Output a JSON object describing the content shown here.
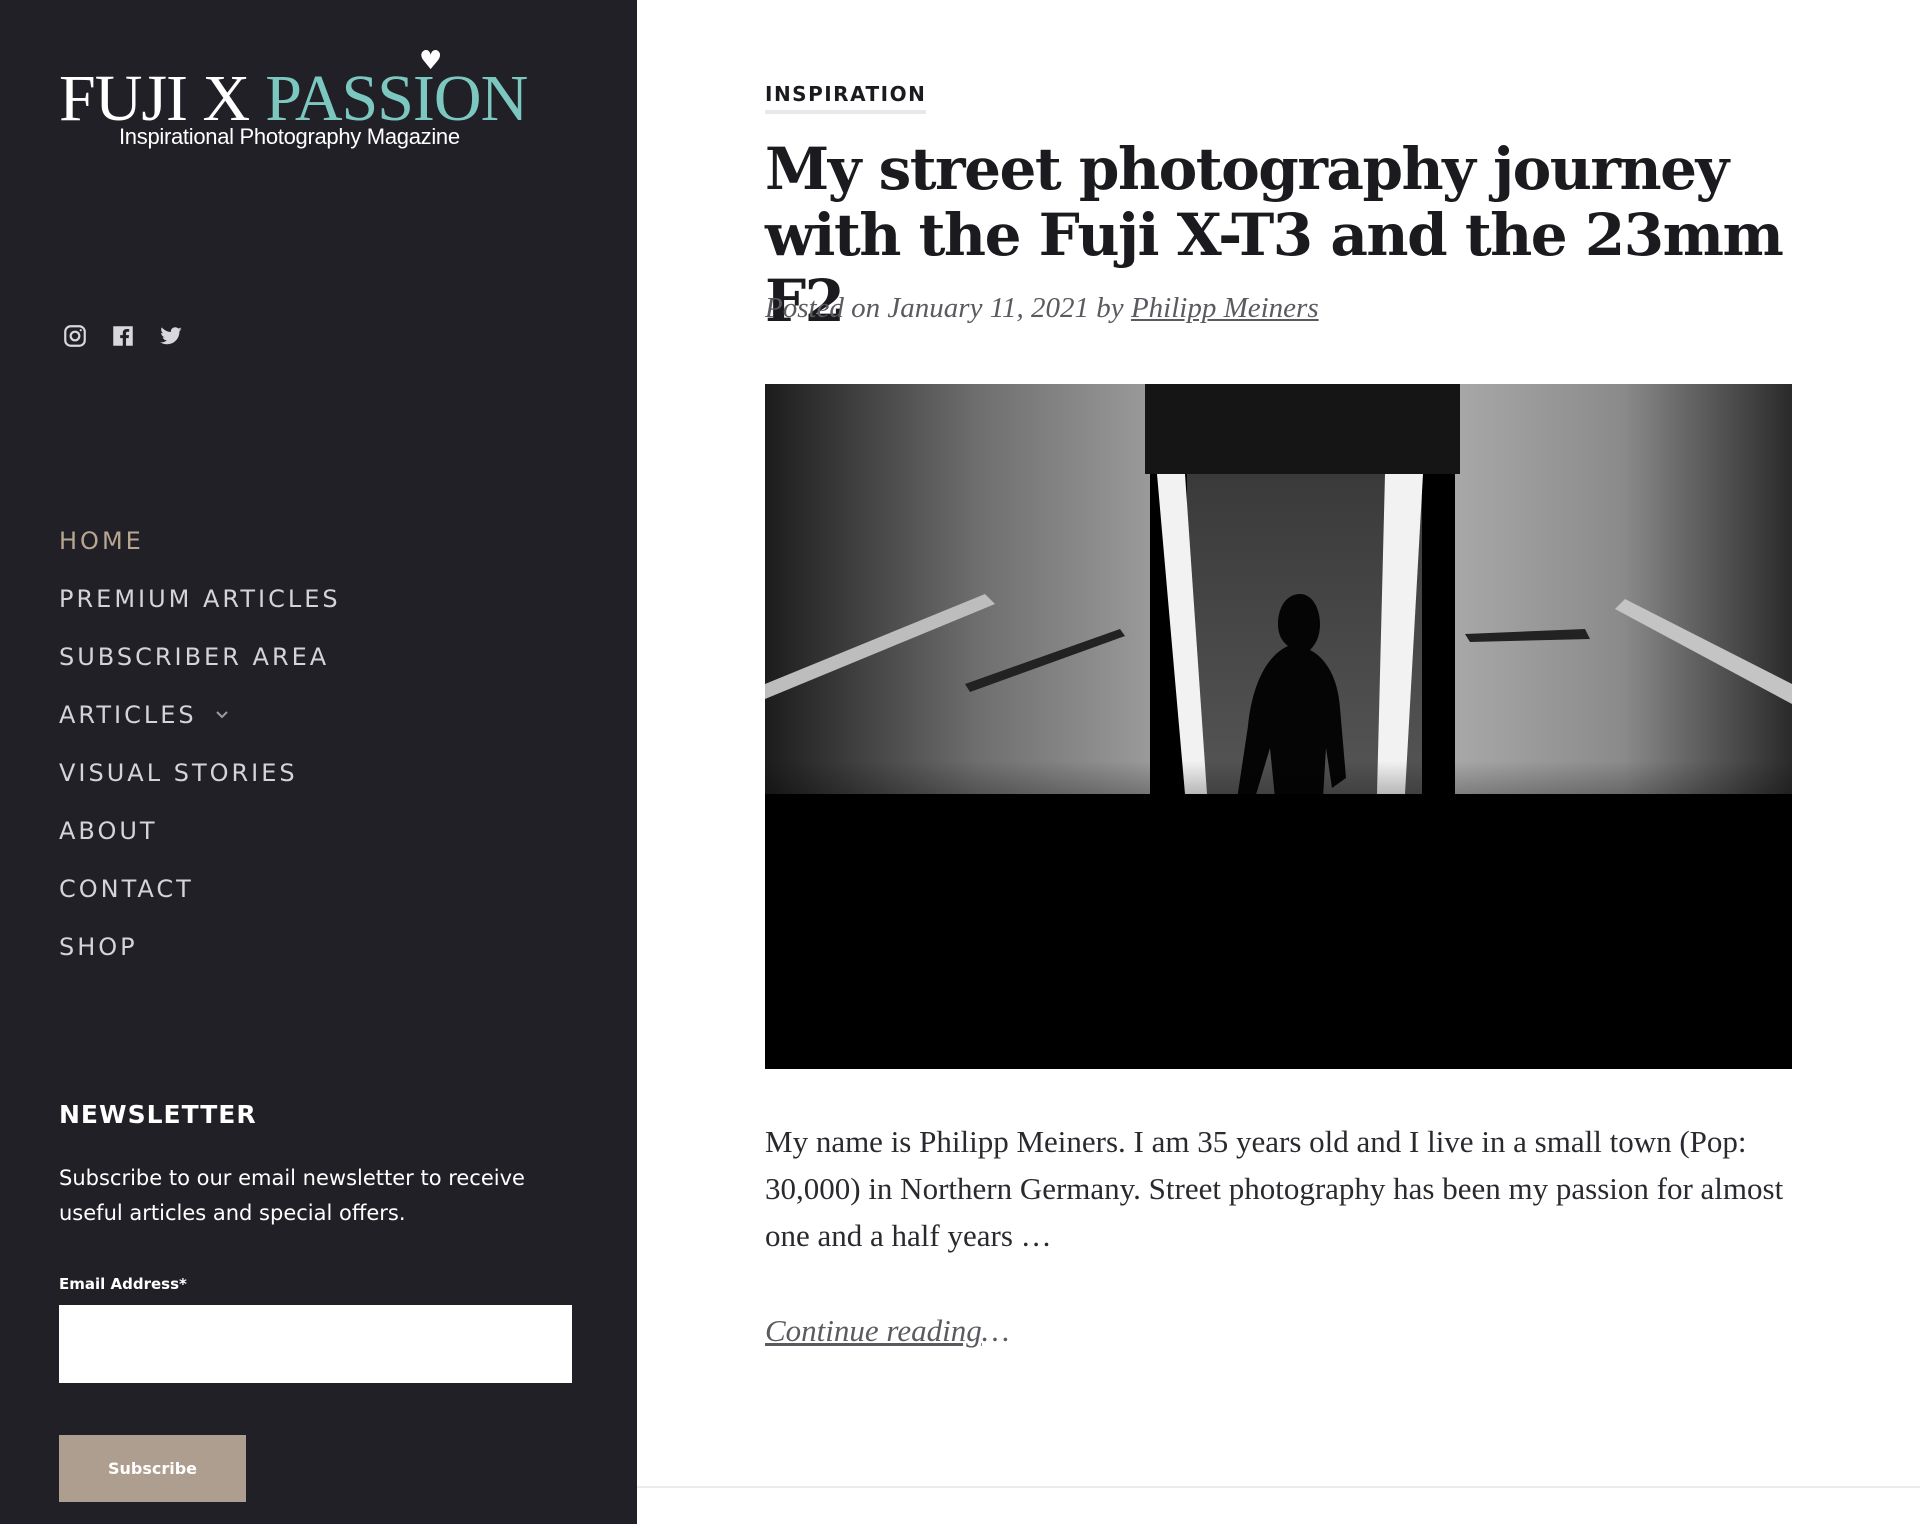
{
  "brand": {
    "name_part1": "FUJI X",
    "name_part2": "PASSION",
    "tagline": "Inspirational Photography Magazine",
    "heart_glyph": "♥",
    "accent_color": "#7cc8c0"
  },
  "social": [
    {
      "icon": "instagram-icon"
    },
    {
      "icon": "facebook-icon"
    },
    {
      "icon": "twitter-icon"
    }
  ],
  "nav": {
    "items": [
      {
        "label": "HOME",
        "active": true
      },
      {
        "label": "PREMIUM ARTICLES"
      },
      {
        "label": "SUBSCRIBER AREA"
      },
      {
        "label": "ARTICLES",
        "has_submenu": true
      },
      {
        "label": "VISUAL STORIES"
      },
      {
        "label": "ABOUT"
      },
      {
        "label": "CONTACT"
      },
      {
        "label": "SHOP"
      }
    ],
    "active_color": "#b8a690"
  },
  "newsletter": {
    "title": "NEWSLETTER",
    "description": "Subscribe to our email newsletter to receive useful articles and special offers.",
    "email_label": "Email Address*",
    "email_value": "",
    "button_label": "Subscribe",
    "button_color": "#ad9e8f"
  },
  "article": {
    "category": "INSPIRATION",
    "title": "My street photography journey with the Fuji X-T3 and the 23mm F2",
    "meta_prefix": "Posted on January 11, 2021 by",
    "author": "Philipp Meiners",
    "excerpt": "My name is Philipp Meiners. I am 35 years old and I live in a small town (Pop: 30,000) in Northern Germany. Street photography has been my passion for almost one and a half years …",
    "continue_label": "Continue reading",
    "continue_suffix": "…"
  },
  "theme": {
    "sidebar_bg": "#202026",
    "text_dark": "#1b1b1f"
  }
}
